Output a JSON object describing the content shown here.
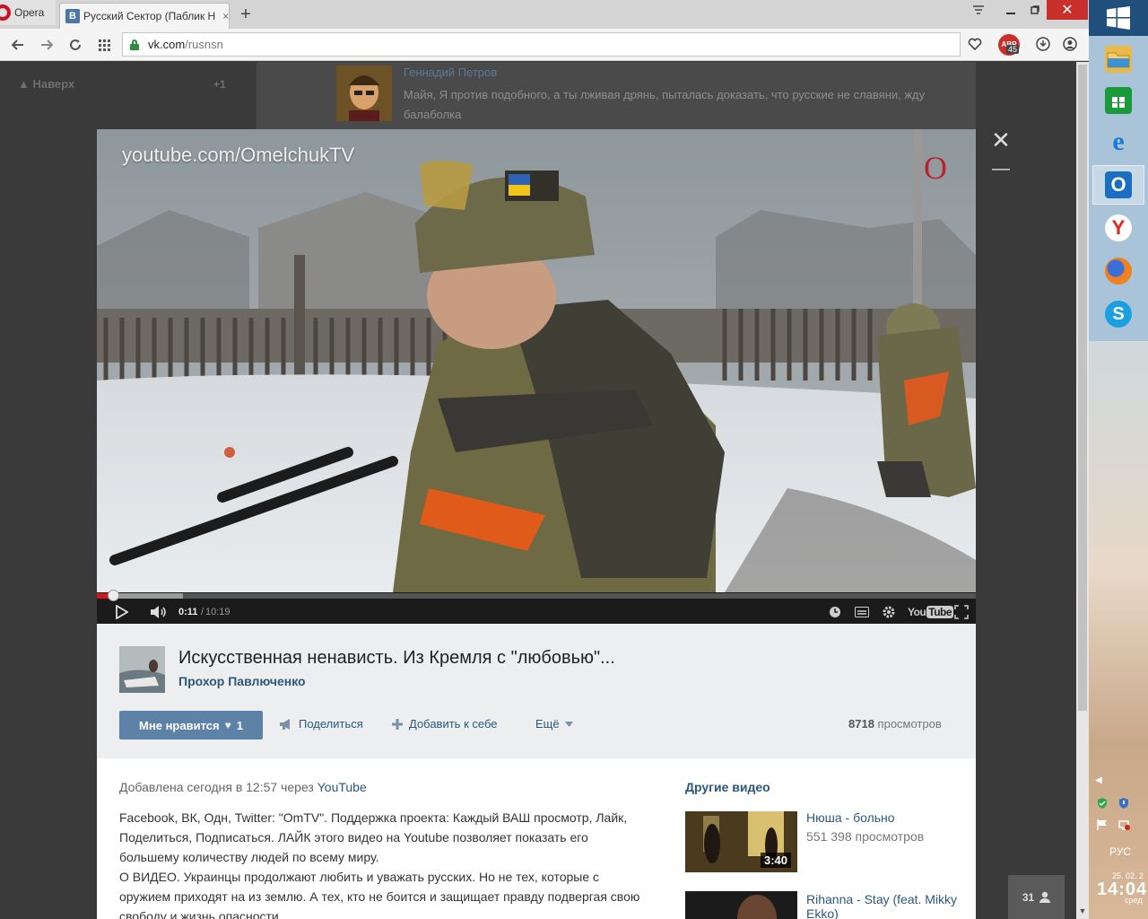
{
  "browser": {
    "menu_label": "Opera",
    "tab_title": "Русский Сектор (Паблик Н",
    "tab_favicon": "В",
    "url_domain": "vk.com",
    "url_path": "/rusnsn",
    "adblock_label": "ABP",
    "adblock_count": "45"
  },
  "page_bg": {
    "up_label": "Наверх",
    "up_count": "+1",
    "comment_author": "Геннадий Петров",
    "comment_text": "Майя, Я против подобного, а ты лживая дрянь, пыталась доказать, что русские не славяни, жду балаболка"
  },
  "player": {
    "watermark": "youtube.com/OmelchukTV",
    "channel_logo": "O",
    "current_time": "0:11",
    "separator": "/",
    "duration": "10:19",
    "progress": 0.018,
    "buffered": 0.098,
    "youtube_word": "You",
    "youtube_tube": "Tube"
  },
  "video": {
    "title": "Искусственная ненависть. Из Кремля с \"любовью\"...",
    "author": "Прохор Павлюченко",
    "like_label": "Мне нравится",
    "like_count": "1",
    "share_label": "Поделиться",
    "add_label": "Добавить к себе",
    "more_label": "Ещё",
    "views_number": "8718",
    "views_label": "просмотров",
    "added_prefix": "Добавлена сегодня в 12:57 через",
    "added_source": "YouTube",
    "description": "Facebook, ВК, Одн, Twitter: \"OmTV\". Поддержка проекта: Каждый ВАШ просмотр, Лайк, Поделиться, Подписаться. ЛАЙК этого видео на Youtube позволяет показать его большему количеству людей по всему миру.\nО ВИДЕО. Украинцы продолжают любить и уважать русских. Но не тех, которые с оружием приходят на из землю. А тех, кто не боится и защищает правду подвергая свою свободу и жизнь опасности."
  },
  "other_videos": {
    "heading": "Другие видео",
    "items": [
      {
        "title": "Нюша - больно",
        "views": "551 398 просмотров",
        "duration": "3:40"
      },
      {
        "title": "Rihanna - Stay (feat. Mikky Ekko)"
      }
    ]
  },
  "friends_online": "31",
  "taskbar": {
    "language": "РУС",
    "date": "25. 02. 2",
    "time": "14:04",
    "weekday": "сред"
  },
  "colors": {
    "vk_blue": "#2b587a",
    "like_button": "#5e81a8",
    "youtube_red": "#cc181e",
    "close_red": "#c9302c"
  },
  "icons": [
    "opera-logo-icon",
    "vk-favicon-icon",
    "tab-close-icon",
    "new-tab-icon",
    "tab-menu-icon",
    "minimize-icon",
    "maximize-icon",
    "close-icon",
    "back-icon",
    "forward-icon",
    "reload-icon",
    "speed-dial-icon",
    "lock-icon",
    "heart-icon",
    "download-icon",
    "account-icon",
    "play-icon",
    "volume-icon",
    "clock-icon",
    "captions-icon",
    "settings-icon",
    "fullscreen-icon",
    "share-icon",
    "plus-icon",
    "chevron-down-icon",
    "user-icon",
    "windows-logo-icon"
  ]
}
